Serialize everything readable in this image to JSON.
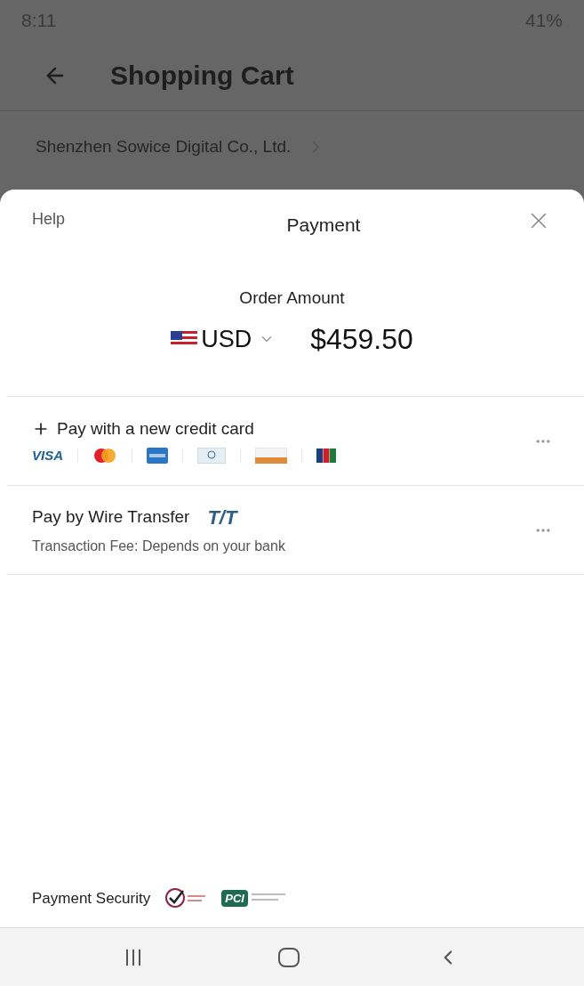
{
  "status_bar": {
    "time": "8:11",
    "battery": "41%"
  },
  "header": {
    "title": "Shopping Cart"
  },
  "seller": {
    "name": "Shenzhen Sowice Digital Co., Ltd."
  },
  "sheet": {
    "help": "Help",
    "title": "Payment",
    "order_label": "Order Amount",
    "currency": "USD",
    "amount": "$459.50"
  },
  "methods": [
    {
      "kind": "card",
      "title": "Pay with a new credit card",
      "brand_text": "VISA"
    },
    {
      "kind": "wire",
      "title": "Pay by Wire Transfer",
      "badge": "T/T",
      "note": "Transaction Fee: Depends on your bank"
    }
  ],
  "security": {
    "label": "Payment Security",
    "pci": "PCI"
  }
}
